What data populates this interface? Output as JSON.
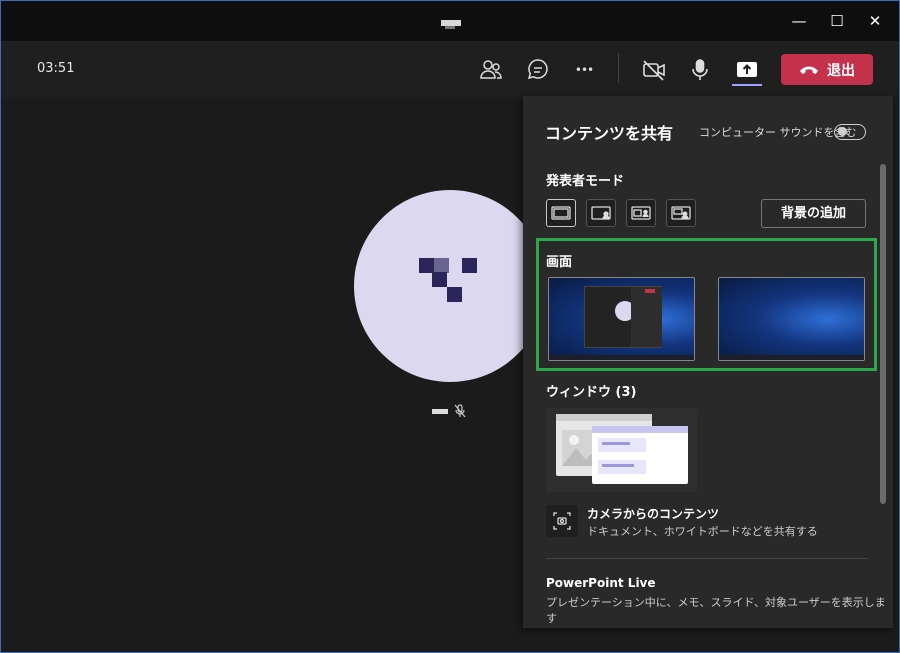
{
  "window": {
    "minimize_glyph": "—",
    "maximize_glyph": "☐",
    "close_glyph": "✕"
  },
  "toolbar": {
    "timer": "03:51",
    "icons": [
      "participants-icon",
      "chat-icon",
      "more-icon",
      "camera-off-icon",
      "microphone-icon",
      "share-icon"
    ],
    "more_glyph": "•••",
    "leave_label": "退出",
    "leave_color": "#c4314b",
    "share_accent": "#9ea2ff"
  },
  "stage": {
    "avatar_bg": "#dcd8ef",
    "avatar_pixel_color": "#2b2559"
  },
  "share_panel": {
    "title": "コンテンツを共有",
    "computer_sound_label": "コンピューター サウンドを含む",
    "computer_sound_on": false,
    "presenter_mode_label": "発表者モード",
    "presenter_modes": [
      "content-only",
      "standout",
      "side-by-side",
      "reporter"
    ],
    "add_background_label": "背景の追加",
    "screen_section_label": "画面",
    "screen_count": 2,
    "highlight_color": "#2aa84a",
    "window_section_label": "ウィンドウ (3)",
    "camera_content": {
      "title": "カメラからのコンテンツ",
      "subtitle": "ドキュメント、ホワイトボードなどを共有する"
    },
    "powerpoint_live": {
      "title": "PowerPoint Live",
      "subtitle": "プレゼンテーション中に、メモ、スライド、対象ユーザーを表示します"
    }
  }
}
